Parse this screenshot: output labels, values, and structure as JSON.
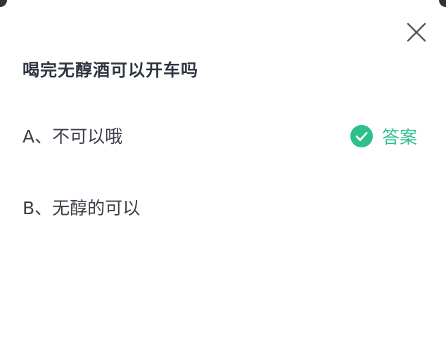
{
  "dialog": {
    "question": "喝完无醇酒可以开车吗",
    "options": [
      {
        "label": "A、不可以哦",
        "is_answer": true
      },
      {
        "label": "B、无醇的可以",
        "is_answer": false
      }
    ],
    "answer_badge": "答案"
  },
  "icons": {
    "close": "close-icon",
    "check": "check-circle-icon"
  },
  "colors": {
    "accent": "#2ec08b",
    "text": "#3b3f48",
    "title": "#2e3440",
    "close": "#555555"
  }
}
